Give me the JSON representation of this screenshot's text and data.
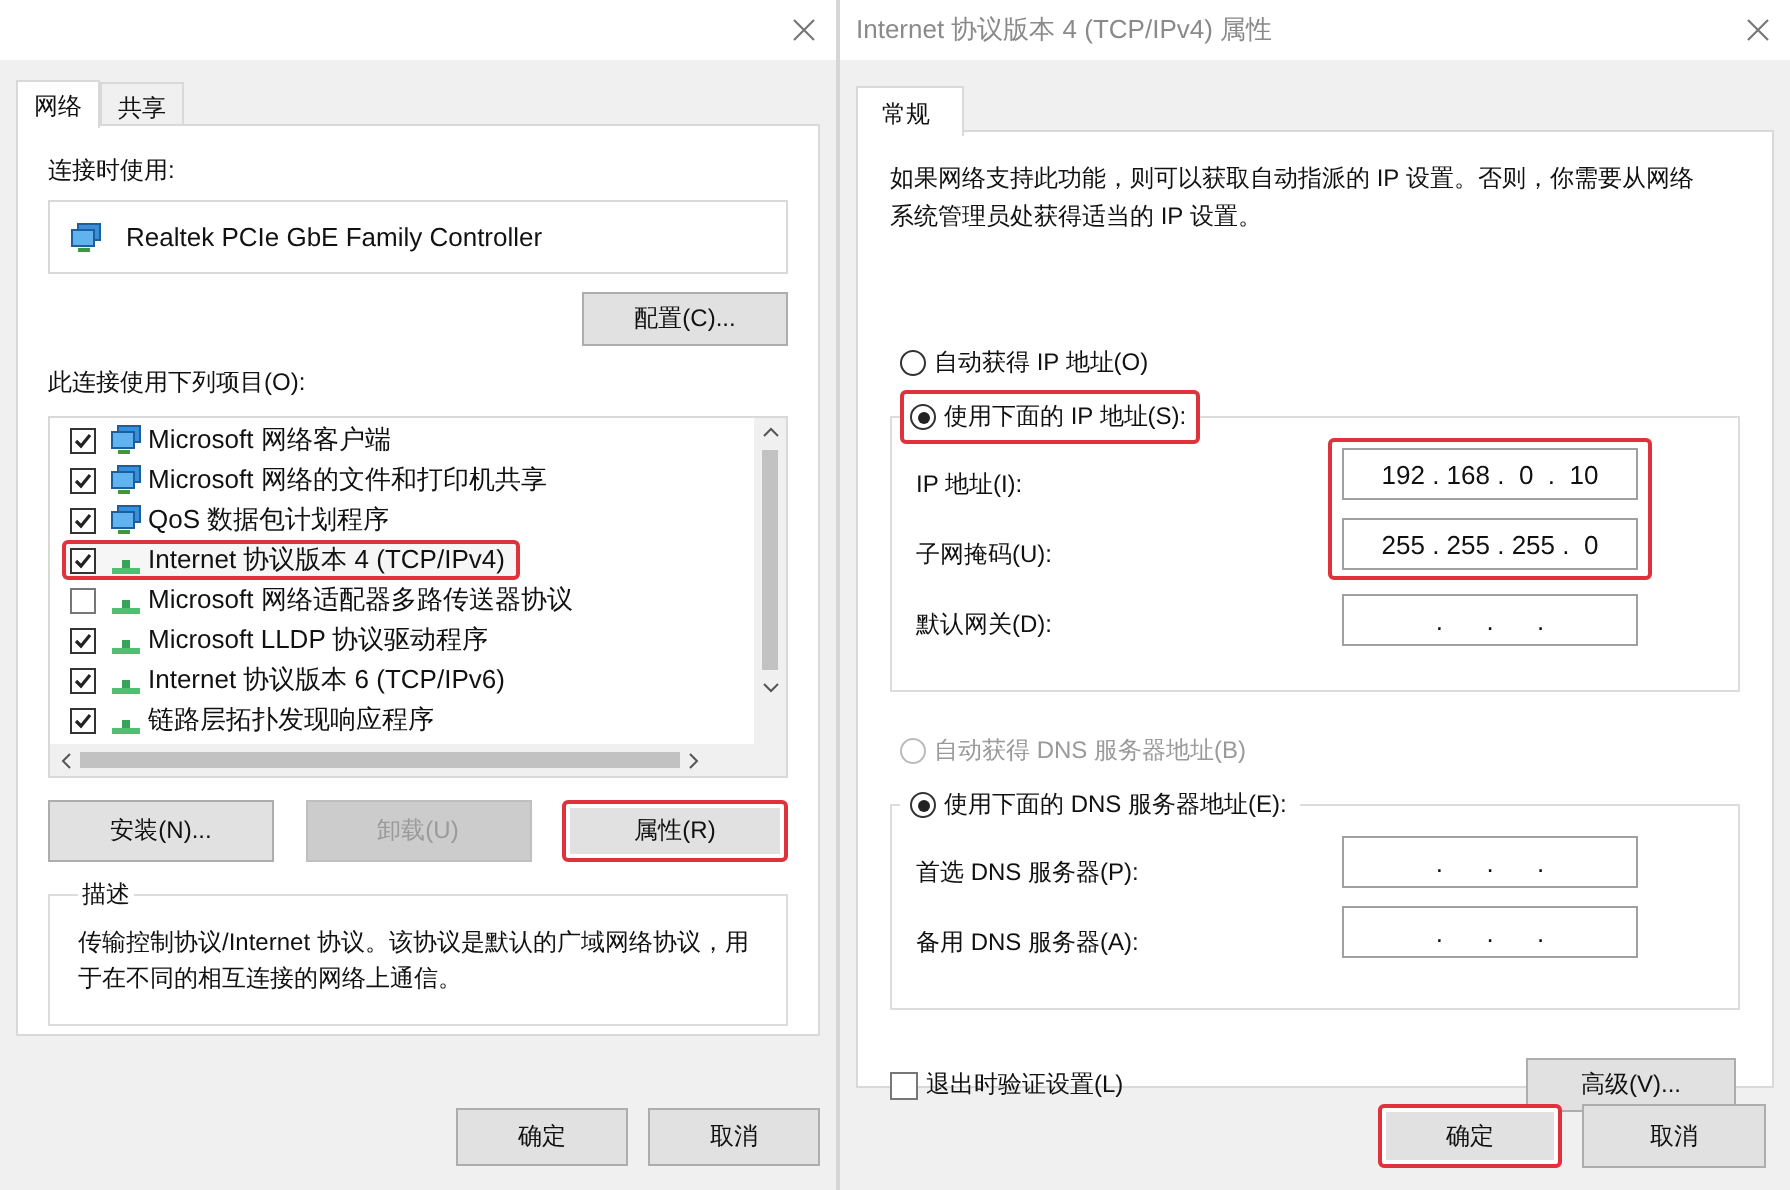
{
  "left_dialog": {
    "tabs": [
      {
        "label": "网络",
        "selected": true
      },
      {
        "label": "共享",
        "selected": false
      }
    ],
    "connect_using_label": "连接时使用:",
    "adapter": "Realtek PCIe GbE Family Controller",
    "configure_button": "配置(C)...",
    "items_label": "此连接使用下列项目(O):",
    "items": [
      {
        "label": "Microsoft 网络客户端",
        "checked": true,
        "kind": "service",
        "highlighted": false
      },
      {
        "label": "Microsoft 网络的文件和打印机共享",
        "checked": true,
        "kind": "service",
        "highlighted": false
      },
      {
        "label": "QoS 数据包计划程序",
        "checked": true,
        "kind": "service",
        "highlighted": false
      },
      {
        "label": "Internet 协议版本 4 (TCP/IPv4)",
        "checked": true,
        "kind": "protocol",
        "highlighted": true
      },
      {
        "label": "Microsoft 网络适配器多路传送器协议",
        "checked": false,
        "kind": "protocol",
        "highlighted": false
      },
      {
        "label": "Microsoft LLDP 协议驱动程序",
        "checked": true,
        "kind": "protocol",
        "highlighted": false
      },
      {
        "label": "Internet 协议版本 6 (TCP/IPv6)",
        "checked": true,
        "kind": "protocol",
        "highlighted": false
      },
      {
        "label": "链路层拓扑发现响应程序",
        "checked": true,
        "kind": "protocol",
        "highlighted": false
      }
    ],
    "buttons": [
      {
        "label": "安装(N)...",
        "disabled": false,
        "highlighted": false
      },
      {
        "label": "卸载(U)",
        "disabled": true,
        "highlighted": false
      },
      {
        "label": "属性(R)",
        "disabled": false,
        "highlighted": true
      }
    ],
    "description": {
      "title": "描述",
      "text": "传输控制协议/Internet 协议。该协议是默认的广域网络协议，用于在不同的相互连接的网络上通信。"
    },
    "footer_buttons": [
      {
        "label": "确定",
        "highlighted": false
      },
      {
        "label": "取消",
        "highlighted": false
      }
    ]
  },
  "right_dialog": {
    "title": "Internet 协议版本 4 (TCP/IPv4) 属性",
    "tabs": [
      {
        "label": "常规",
        "selected": true
      }
    ],
    "intro": "如果网络支持此功能，则可以获取自动指派的 IP 设置。否则，你需要从网络系统管理员处获得适当的 IP 设置。",
    "ip_auto": {
      "label": "自动获得 IP 地址(O)",
      "selected": false,
      "disabled": false,
      "highlighted": false
    },
    "ip_manual": {
      "label": "使用下面的 IP 地址(S):",
      "selected": true,
      "disabled": false,
      "highlighted": true
    },
    "ip_fields": [
      {
        "label": "IP 地址(I):",
        "value": "192 . 168 .  0  .  10",
        "highlighted": true
      },
      {
        "label": "子网掩码(U):",
        "value": "255 . 255 . 255 .  0",
        "highlighted": true
      },
      {
        "label": "默认网关(D):",
        "value": ".      .      .",
        "highlighted": false
      }
    ],
    "dns_auto": {
      "label": "自动获得 DNS 服务器地址(B)",
      "selected": false,
      "disabled": true,
      "highlighted": false
    },
    "dns_manual": {
      "label": "使用下面的 DNS 服务器地址(E):",
      "selected": true,
      "disabled": false,
      "highlighted": false
    },
    "dns_fields": [
      {
        "label": "首选 DNS 服务器(P):",
        "value": ".      .      .",
        "highlighted": false
      },
      {
        "label": "备用 DNS 服务器(A):",
        "value": ".      .      .",
        "highlighted": false
      }
    ],
    "validate_checkbox": {
      "label": "退出时验证设置(L)",
      "checked": false
    },
    "advanced_button": "高级(V)...",
    "footer_buttons": [
      {
        "label": "确定",
        "highlighted": true
      },
      {
        "label": "取消",
        "highlighted": false
      }
    ]
  }
}
